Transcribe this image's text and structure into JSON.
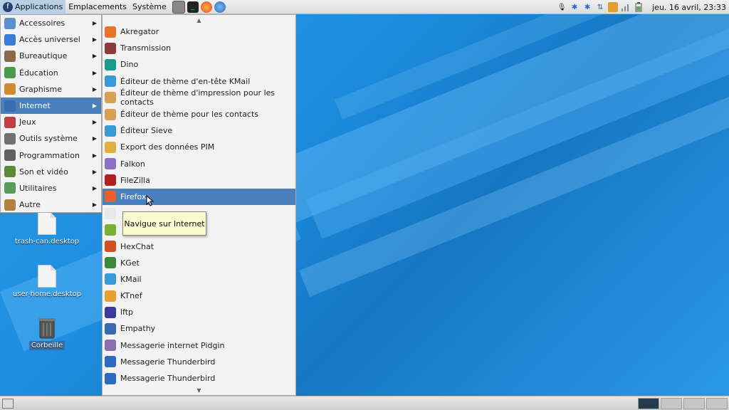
{
  "top_panel": {
    "menus": [
      "Applications",
      "Emplacements",
      "Système"
    ],
    "launchers": [
      "terminal-icon",
      "console-icon",
      "firefox-icon",
      "thunderbird-icon"
    ],
    "clock": "jeu. 16 avril, 23:33",
    "tray_icons": [
      "microphone-icon",
      "bluetooth-icon",
      "bluetooth-icon",
      "network-icon",
      "package-icon",
      "network-signal-icon",
      "battery-icon"
    ]
  },
  "desktop": {
    "icons": [
      {
        "label": "trash-can.desktop",
        "icon": "file-icon"
      },
      {
        "label": "user-home.desktop",
        "icon": "file-icon"
      },
      {
        "label": "Corbeille",
        "icon": "trash-icon"
      }
    ]
  },
  "categories": [
    {
      "label": "Accessoires",
      "icon": "accessories-icon",
      "color": "#5b8fd0"
    },
    {
      "label": "Accès universel",
      "icon": "accessibility-icon",
      "color": "#3a7bd5"
    },
    {
      "label": "Bureautique",
      "icon": "office-icon",
      "color": "#8a6a4a"
    },
    {
      "label": "Éducation",
      "icon": "education-icon",
      "color": "#4a9a4a"
    },
    {
      "label": "Graphisme",
      "icon": "graphics-icon",
      "color": "#d08a30"
    },
    {
      "label": "Internet",
      "icon": "internet-icon",
      "color": "#3a6ab0",
      "active": true
    },
    {
      "label": "Jeux",
      "icon": "games-icon",
      "color": "#c04040"
    },
    {
      "label": "Outils système",
      "icon": "system-tools-icon",
      "color": "#707070"
    },
    {
      "label": "Programmation",
      "icon": "programming-icon",
      "color": "#606060"
    },
    {
      "label": "Son et vidéo",
      "icon": "multimedia-icon",
      "color": "#5a8a3a"
    },
    {
      "label": "Utilitaires",
      "icon": "utilities-icon",
      "color": "#5a9a5a"
    },
    {
      "label": "Autre",
      "icon": "other-icon",
      "color": "#b08040"
    }
  ],
  "apps": [
    {
      "label": "Akregator",
      "icon": "akregator-icon",
      "color": "#e8742a"
    },
    {
      "label": "Transmission",
      "icon": "transmission-icon",
      "color": "#8a3a3a"
    },
    {
      "label": "Dino",
      "icon": "dino-icon",
      "color": "#1a9a8a"
    },
    {
      "label": "Éditeur de thème d'en-tête KMail",
      "icon": "kmail-icon",
      "color": "#3a9ad8"
    },
    {
      "label": "Éditeur de thème d'impression pour les contacts",
      "icon": "contacts-theme-icon",
      "color": "#d8a050"
    },
    {
      "label": "Éditeur de thème pour les contacts",
      "icon": "contacts-theme-icon",
      "color": "#d8a050"
    },
    {
      "label": "Éditeur Sieve",
      "icon": "sieve-icon",
      "color": "#3a9ad8"
    },
    {
      "label": "Export des données PIM",
      "icon": "pim-export-icon",
      "color": "#e0b040"
    },
    {
      "label": "Falkon",
      "icon": "falkon-icon",
      "color": "#8a70c8"
    },
    {
      "label": "FileZilla",
      "icon": "filezilla-icon",
      "color": "#b02020"
    },
    {
      "label": "Firefox",
      "icon": "firefox-icon",
      "color": "#e8602a",
      "active": true
    },
    {
      "label": "",
      "icon": "email-icon",
      "color": "#e8e8e8"
    },
    {
      "label": "",
      "icon": "chat-icon",
      "color": "#7ab030"
    },
    {
      "label": "HexChat",
      "icon": "hexchat-icon",
      "color": "#d05020"
    },
    {
      "label": "KGet",
      "icon": "kget-icon",
      "color": "#3a8a3a"
    },
    {
      "label": "KMail",
      "icon": "kmail-icon",
      "color": "#3a9ad8"
    },
    {
      "label": "KTnef",
      "icon": "ktnef-icon",
      "color": "#e8a030"
    },
    {
      "label": "lftp",
      "icon": "lftp-icon",
      "color": "#3a3a9a"
    },
    {
      "label": "Empathy",
      "icon": "empathy-icon",
      "color": "#3a6ab0"
    },
    {
      "label": "Messagerie internet Pidgin",
      "icon": "pidgin-icon",
      "color": "#8a70b0"
    },
    {
      "label": "Messagerie Thunderbird",
      "icon": "thunderbird-icon",
      "color": "#2a6ac0"
    },
    {
      "label": "Messagerie Thunderbird",
      "icon": "thunderbird-icon",
      "color": "#2a6ac0"
    }
  ],
  "tooltip": "Navigue sur Internet"
}
